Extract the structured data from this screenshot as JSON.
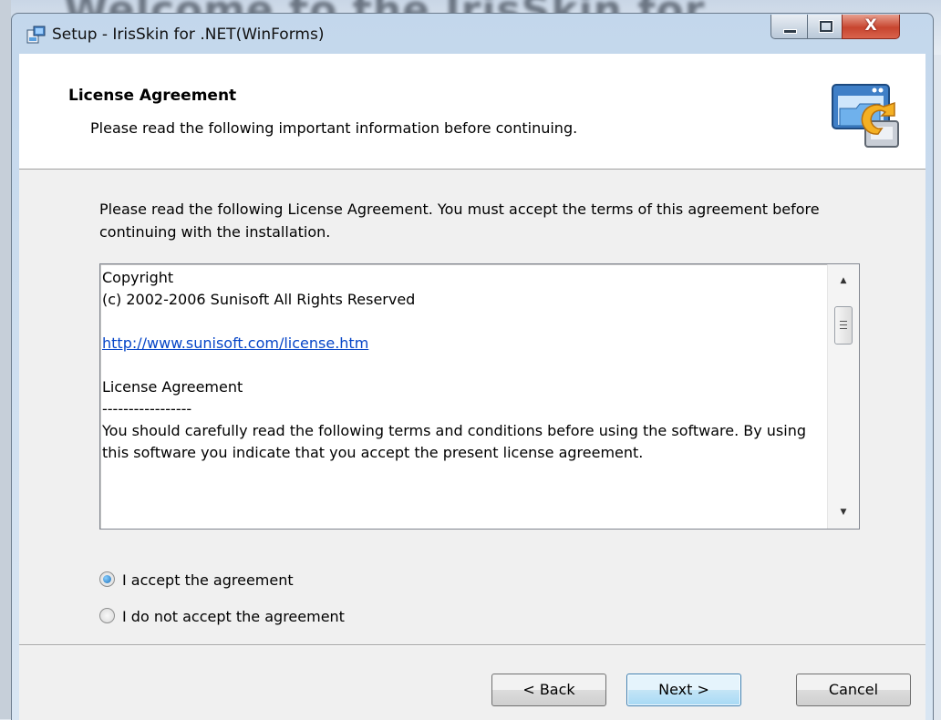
{
  "background_window": {
    "title_fragment": "Welcome to the IrisSkin for"
  },
  "window": {
    "title": "Setup - IrisSkin for .NET(WinForms)",
    "controls": {
      "minimize": "minimize",
      "maximize": "maximize",
      "close": "X"
    }
  },
  "header": {
    "title": "License Agreement",
    "subtitle": "Please read the following important information before continuing."
  },
  "intro_text": "Please read the following License Agreement. You must accept the terms of this agreement before continuing with the installation.",
  "license": {
    "lines": [
      "Copyright",
      "(c) 2002-2006 Sunisoft All Rights Reserved",
      "",
      "http://www.sunisoft.com/license.htm",
      "",
      "License Agreement",
      "-----------------",
      "You should carefully read the following terms and conditions before using the software. By using this software you indicate that you accept the present license agreement."
    ]
  },
  "options": {
    "accept": {
      "label": "I accept the agreement",
      "checked": true
    },
    "decline": {
      "label": "I do not accept the agreement",
      "checked": false
    }
  },
  "buttons": {
    "back": "< Back",
    "next": "Next >",
    "cancel": "Cancel"
  },
  "colors": {
    "link": "#0645c8",
    "close_button": "#c7452f",
    "accent": "#1e6fb8"
  }
}
